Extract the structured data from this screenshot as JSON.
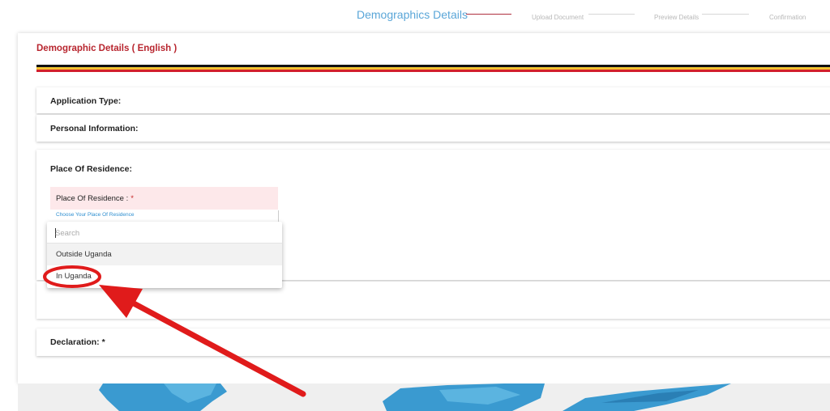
{
  "stepper": {
    "steps": [
      {
        "label": "Demographics Details"
      },
      {
        "label": "Upload Document"
      },
      {
        "label": "Preview Details"
      },
      {
        "label": "Confirmation"
      }
    ]
  },
  "form": {
    "title": "Demographic Details ( English )",
    "flag_colors": [
      "#111111",
      "#f2c230",
      "#d21f2c"
    ],
    "sections": {
      "application_type": "Application Type:",
      "personal_information": "Personal Information:",
      "place_of_residence": "Place Of Residence:",
      "declaration": "Declaration: *"
    },
    "residence_field": {
      "label": "Place Of Residence :",
      "required_mark": "*",
      "placeholder": "Choose Your Place Of Residence"
    }
  },
  "dropdown": {
    "search_placeholder": "Search",
    "options": [
      "Outside Uganda",
      "In Uganda"
    ]
  },
  "annotation": {
    "color": "#e01b1b",
    "highlighted_option": "In Uganda"
  },
  "map_color": "#3a9ad0"
}
